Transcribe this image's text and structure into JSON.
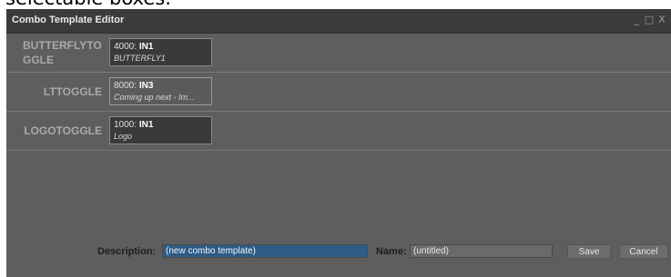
{
  "caption": "selectable boxes.",
  "window": {
    "title": "Combo Template Editor",
    "controls": [
      "_",
      "□",
      "X"
    ]
  },
  "rows": [
    {
      "label": "BUTTERFLYTOGGLE",
      "slot_number": "4000:",
      "slot_input": "IN1",
      "slot_subtitle": "BUTTERFLY1"
    },
    {
      "label": "LTTOGGLE",
      "slot_number": "8000:",
      "slot_input": "IN3",
      "slot_subtitle": "Coming up next - Im..."
    },
    {
      "label": "LOGOTOGGLE",
      "slot_number": "1000:",
      "slot_input": "IN1",
      "slot_subtitle": "Logo"
    }
  ],
  "footer": {
    "description_label": "Description:",
    "description_value": "(new combo template)",
    "name_label": "Name:",
    "name_value": "(untitled)",
    "save_label": "Save",
    "cancel_label": "Cancel"
  }
}
